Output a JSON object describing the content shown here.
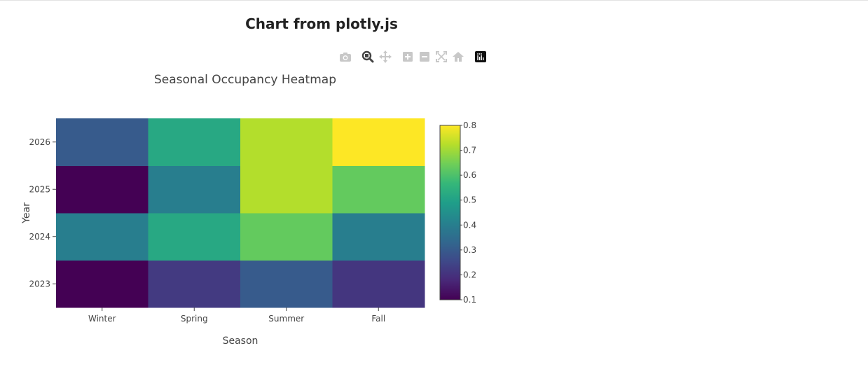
{
  "page": {
    "title": "Chart from plotly.js"
  },
  "modebar": {
    "buttons": [
      {
        "name": "camera-icon"
      },
      {
        "name": "zoom-icon"
      },
      {
        "name": "pan-icon"
      },
      {
        "name": "zoom-in-icon"
      },
      {
        "name": "zoom-out-icon"
      },
      {
        "name": "autoscale-icon"
      },
      {
        "name": "reset-axes-icon"
      },
      {
        "name": "plotly-logo-icon"
      }
    ]
  },
  "chart_data": {
    "type": "heatmap",
    "title": "Seasonal Occupancy Heatmap",
    "xlabel": "Season",
    "ylabel": "Year",
    "x": [
      "Winter",
      "Spring",
      "Summer",
      "Fall"
    ],
    "y": [
      "2023",
      "2024",
      "2025",
      "2026"
    ],
    "z": [
      [
        0.1,
        0.22,
        0.3,
        0.21
      ],
      [
        0.4,
        0.52,
        0.63,
        0.4
      ],
      [
        0.1,
        0.4,
        0.72,
        0.63
      ],
      [
        0.3,
        0.52,
        0.72,
        0.8
      ]
    ],
    "colorscale": "Viridis",
    "zmin": 0.1,
    "zmax": 0.8,
    "colorbar_ticks": [
      "0.1",
      "0.2",
      "0.3",
      "0.4",
      "0.5",
      "0.6",
      "0.7",
      "0.8"
    ],
    "colors": {
      "viridis": [
        "#440154",
        "#482878",
        "#3e4989",
        "#31688e",
        "#26828e",
        "#1f9e89",
        "#35b779",
        "#6ece58",
        "#b5de2b",
        "#fde725"
      ],
      "axis_text": "#444444",
      "title_text": "#444444"
    }
  }
}
